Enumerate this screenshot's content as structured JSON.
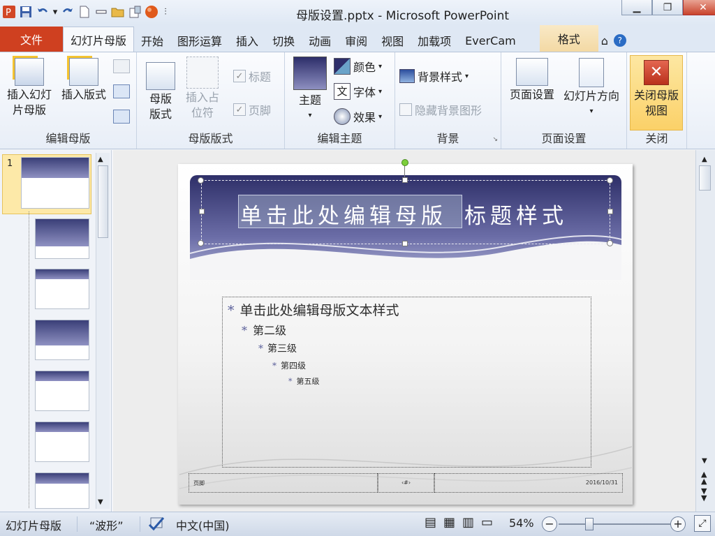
{
  "window": {
    "title": "母版设置.pptx - Microsoft PowerPoint"
  },
  "tabs": [
    "幻灯片母版",
    "开始",
    "图形运算",
    "插入",
    "切换",
    "动画",
    "审阅",
    "视图",
    "加载项",
    "EverCam"
  ],
  "file_tab": "文件",
  "contextual_tab": "格式",
  "ribbon": {
    "edit_master": {
      "label": "编辑母版",
      "insert_slide_master": "插入幻灯片母版",
      "insert_layout": "插入版式"
    },
    "master_layout": {
      "label": "母版版式",
      "master_layout_btn": "母版版式",
      "insert_placeholder": "插入占位符",
      "title_chk": "标题",
      "footer_chk": "页脚"
    },
    "edit_theme": {
      "label": "编辑主题",
      "theme": "主题",
      "colors": "颜色",
      "fonts": "字体",
      "effects": "效果"
    },
    "background": {
      "label": "背景",
      "bg_styles": "背景样式",
      "hide_bg": "隐藏背景图形"
    },
    "page_setup": {
      "label": "页面设置",
      "page_setup_btn": "页面设置",
      "orientation": "幻灯片方向"
    },
    "close": {
      "label": "关闭",
      "close_master": "关闭母版视图"
    }
  },
  "thumbs": {
    "selected_number": "1"
  },
  "slide": {
    "title_part1": "单击此处编辑母版",
    "title_part2": "标题样式",
    "body_levels": [
      "单击此处编辑母版文本样式",
      "第二级",
      "第三级",
      "第四级",
      "第五级"
    ],
    "bullet": "*",
    "footer_left": "页脚",
    "footer_mid": "‹#›",
    "footer_right": "2016/10/31"
  },
  "status": {
    "view": "幻灯片母版",
    "theme": "“波形”",
    "language": "中文(中国)",
    "zoom": "54%"
  },
  "colors": {
    "file_tab": "#cf4020",
    "banner_top": "#2e2f68",
    "banner_bottom": "#b3b6d8",
    "close_btn": "#c9432c"
  }
}
